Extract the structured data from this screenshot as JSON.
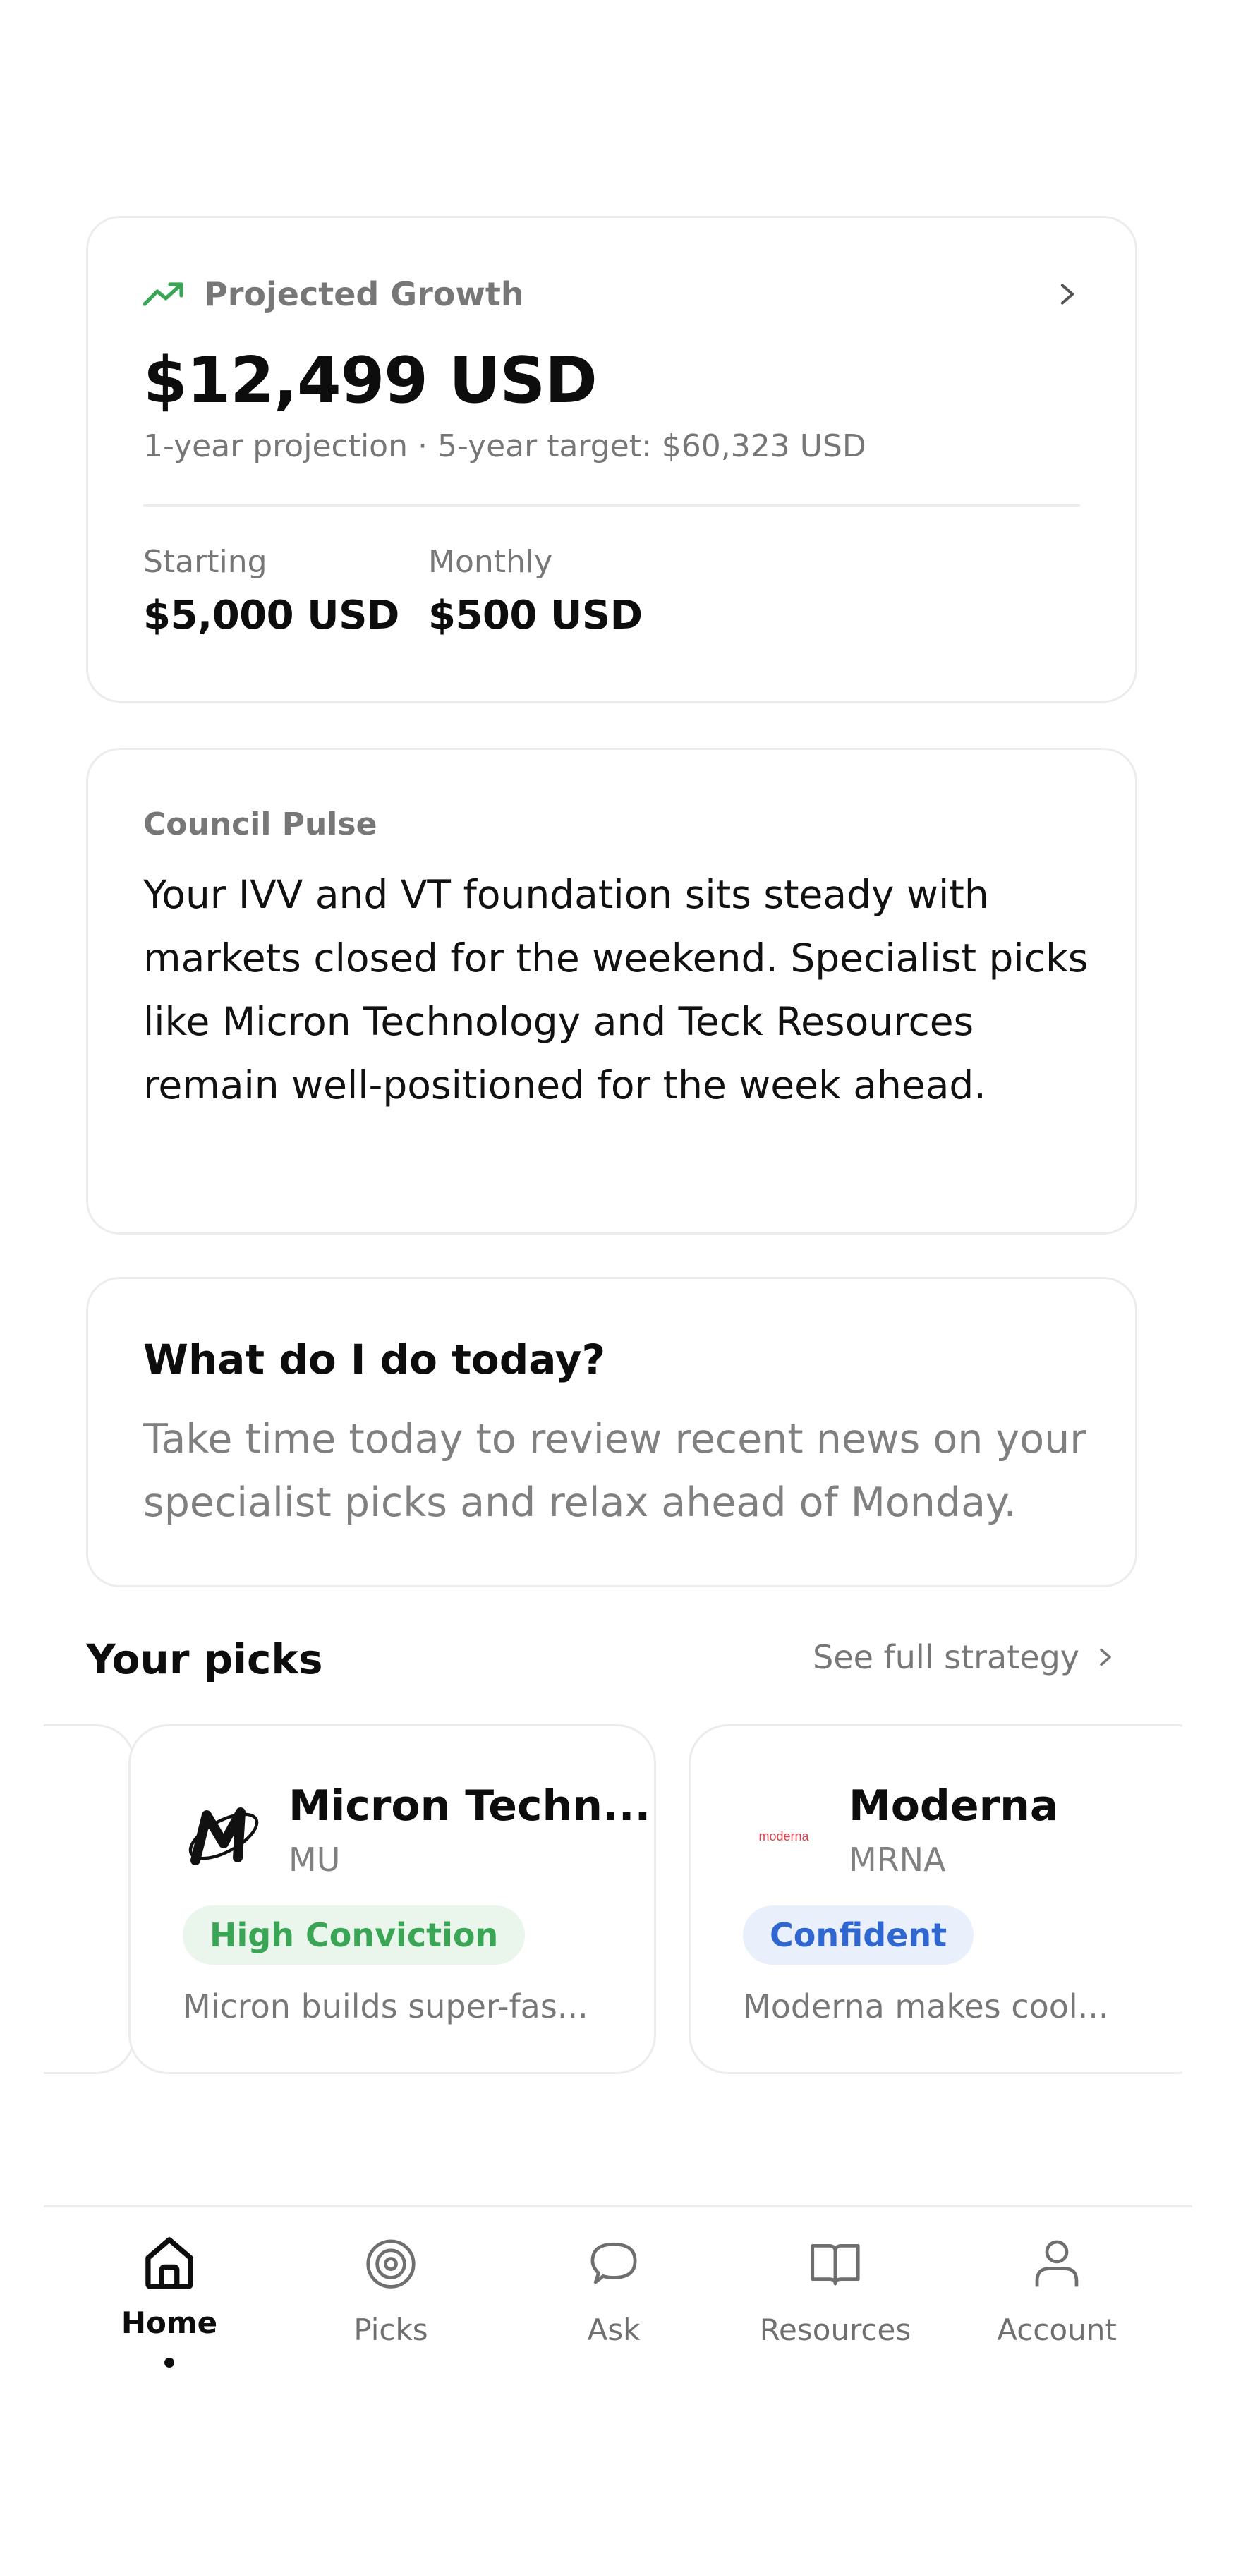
{
  "growth": {
    "label": "Projected Growth",
    "amount": "$12,499 USD",
    "subtitle": "1-year projection · 5-year target: $60,323 USD",
    "starting_label": "Starting",
    "starting_value": "$5,000 USD",
    "monthly_label": "Monthly",
    "monthly_value": "$500 USD",
    "icon": "trending-up-icon",
    "accent_color": "#3aa655"
  },
  "pulse": {
    "title": "Council Pulse",
    "text": "Your IVV and VT foundation sits steady with markets closed for the weekend. Specialist picks like Micron Technology and Teck Resources remain well-positioned for the week ahead."
  },
  "today": {
    "title": "What do I do today?",
    "text": "Take time today to review recent news on your specialist picks and relax ahead of Monday."
  },
  "picks": {
    "title": "Your picks",
    "see_full_strategy": "See full strategy",
    "items": [
      {
        "name": "Micron Techn...",
        "ticker": "MU",
        "badge": "High Conviction",
        "badge_color": "#3aa655",
        "description": "Micron builds super-fas...",
        "logo": "micron-logo"
      },
      {
        "name": "Moderna",
        "ticker": "MRNA",
        "badge": "Confident",
        "badge_color": "#2f66d0",
        "description": "Moderna makes cool...",
        "logo": "moderna-logo",
        "logo_text": "moderna"
      }
    ]
  },
  "nav": {
    "items": [
      {
        "label": "Home",
        "icon": "home-icon",
        "active": true
      },
      {
        "label": "Picks",
        "icon": "target-icon",
        "active": false
      },
      {
        "label": "Ask",
        "icon": "chat-bubble-icon",
        "active": false
      },
      {
        "label": "Resources",
        "icon": "book-icon",
        "active": false
      },
      {
        "label": "Account",
        "icon": "person-icon",
        "active": false
      }
    ]
  }
}
